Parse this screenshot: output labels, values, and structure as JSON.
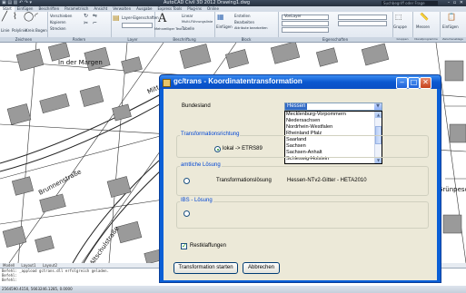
{
  "acad": {
    "title": "AutoCAD Civil 3D 2012   Drawing1.dwg",
    "search_placeholder": "Suchbegriff oder Frage eingeben",
    "tabs": [
      "Start",
      "Einfügen",
      "Beschriften",
      "Parametrisch",
      "Ansicht",
      "Verwalten",
      "Ausgabe",
      "Express Tools",
      "Plug-ins",
      "Online"
    ],
    "groups": {
      "zeichnen": "Zeichnen",
      "aendern": "Ändern",
      "layer": "Layer",
      "beschriftung": "Beschriftung",
      "block": "Block",
      "eigenschaften": "Eigenschaften",
      "gruppen": "Gruppen",
      "dienstprogramme": "Dienstprogramme",
      "zwischenablage": "Zwischenablage"
    },
    "ribbon_items": {
      "linie": "Linie",
      "polylinie": "Polylinie",
      "kreis": "Kreis",
      "bogen": "Bogen",
      "verschieben": "Verschieben",
      "kopieren": "Kopieren",
      "strecken": "Strecken",
      "layereigenschaften": "Layer-Eigenschaften",
      "mehrzeiliger_text": "Mehrzeiliger Text",
      "text_glyph": "A",
      "bemassung": "Linear",
      "fuehrung": "Multi-Führungslinie",
      "tabelle": "Tabelle",
      "einfuegen": "Einfügen",
      "erstellen": "Erstellen",
      "bearbeiten": "Bearbeiten",
      "attribute": "Attribute bearbeiten",
      "vonlayer": "VonLayer",
      "gruppe": "Gruppe",
      "messen": "Messen",
      "einfuegen_clip": "Einfügen"
    }
  },
  "map_labels": {
    "in_der_margen": "In der Margen",
    "mittel": "Mitt",
    "brunnenstrasse": "Brunnenstraße",
    "alteschulstrasse": "Altschulstraße",
    "grunpesch": "Grünpesch"
  },
  "statusbar": {
    "layout_tabs": [
      "Modell",
      "Layout1",
      "Layout2"
    ],
    "cmd_lines": [
      "Befehl: _appload gctrans.dll erfolgreich geladen.",
      "Befehl:",
      "Befehl:"
    ],
    "coords": "2564590.4150, 5663246.1285, 0.0000"
  },
  "dialog": {
    "title": "gc/trans - Koordinatentransformation",
    "bundesland_label": "Bundesland",
    "bundesland_value": "Hessen",
    "bundesland_options": [
      "Mecklenburg-Vorpommern",
      "Niedersachsen",
      "Nordrhein-Westfalen",
      "Rheinland Pfalz",
      "Saarland",
      "Sachsen",
      "Sachsen-Anhalt",
      "Schleswig-Holstein"
    ],
    "group_transformation": "Transformationsrichtung",
    "radio_lokal": "lokal -> ETRS89",
    "group_amtliche": "amtliche Lösung",
    "transformationsloesung_label": "Transformationslösung",
    "transformationsloesung_value": "Hessen-NTv2-Gitter - HETA2010",
    "group_ibs": "IBS - Lösung",
    "restklaffungen_label": "Restklaffungen",
    "restklaffungen_checked": true,
    "btn_start": "Transformation starten",
    "btn_cancel": "Abbrechen"
  }
}
